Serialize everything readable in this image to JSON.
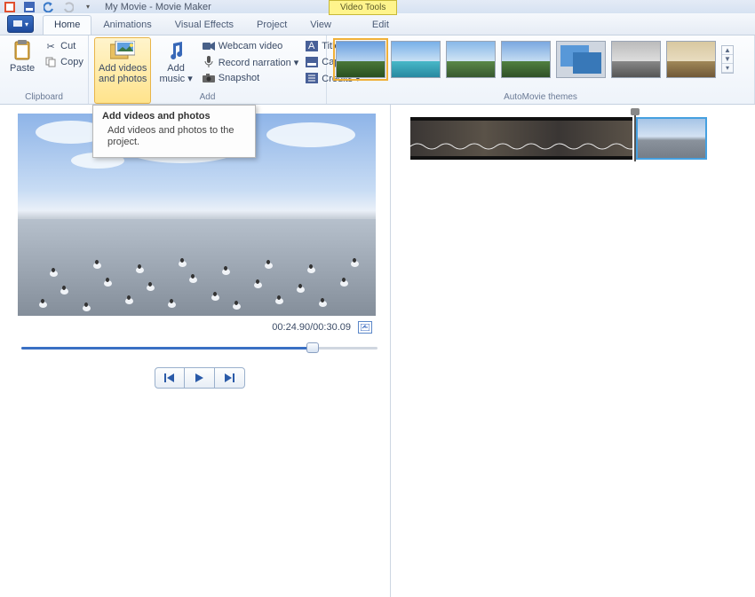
{
  "titlebar": {
    "title": "My Movie - Movie Maker",
    "video_tools": "Video Tools"
  },
  "tabs": {
    "app_glyph": "▾",
    "home": "Home",
    "animations": "Animations",
    "visual_effects": "Visual Effects",
    "project": "Project",
    "view": "View",
    "edit": "Edit"
  },
  "ribbon": {
    "clipboard": {
      "label": "Clipboard",
      "paste": "Paste",
      "cut": "Cut",
      "copy": "Copy"
    },
    "add": {
      "label": "Add",
      "add_videos_photos": "Add videos\nand photos",
      "add_music": "Add\nmusic ▾",
      "webcam": "Webcam video",
      "record": "Record narration ▾",
      "snapshot": "Snapshot",
      "title": "Title",
      "caption": "Caption",
      "credits": "Credits ▾"
    },
    "automovie": {
      "label": "AutoMovie themes"
    }
  },
  "tooltip": {
    "title": "Add videos and photos",
    "body": "Add videos and photos to the project."
  },
  "preview": {
    "time": "00:24.90/00:30.09"
  }
}
